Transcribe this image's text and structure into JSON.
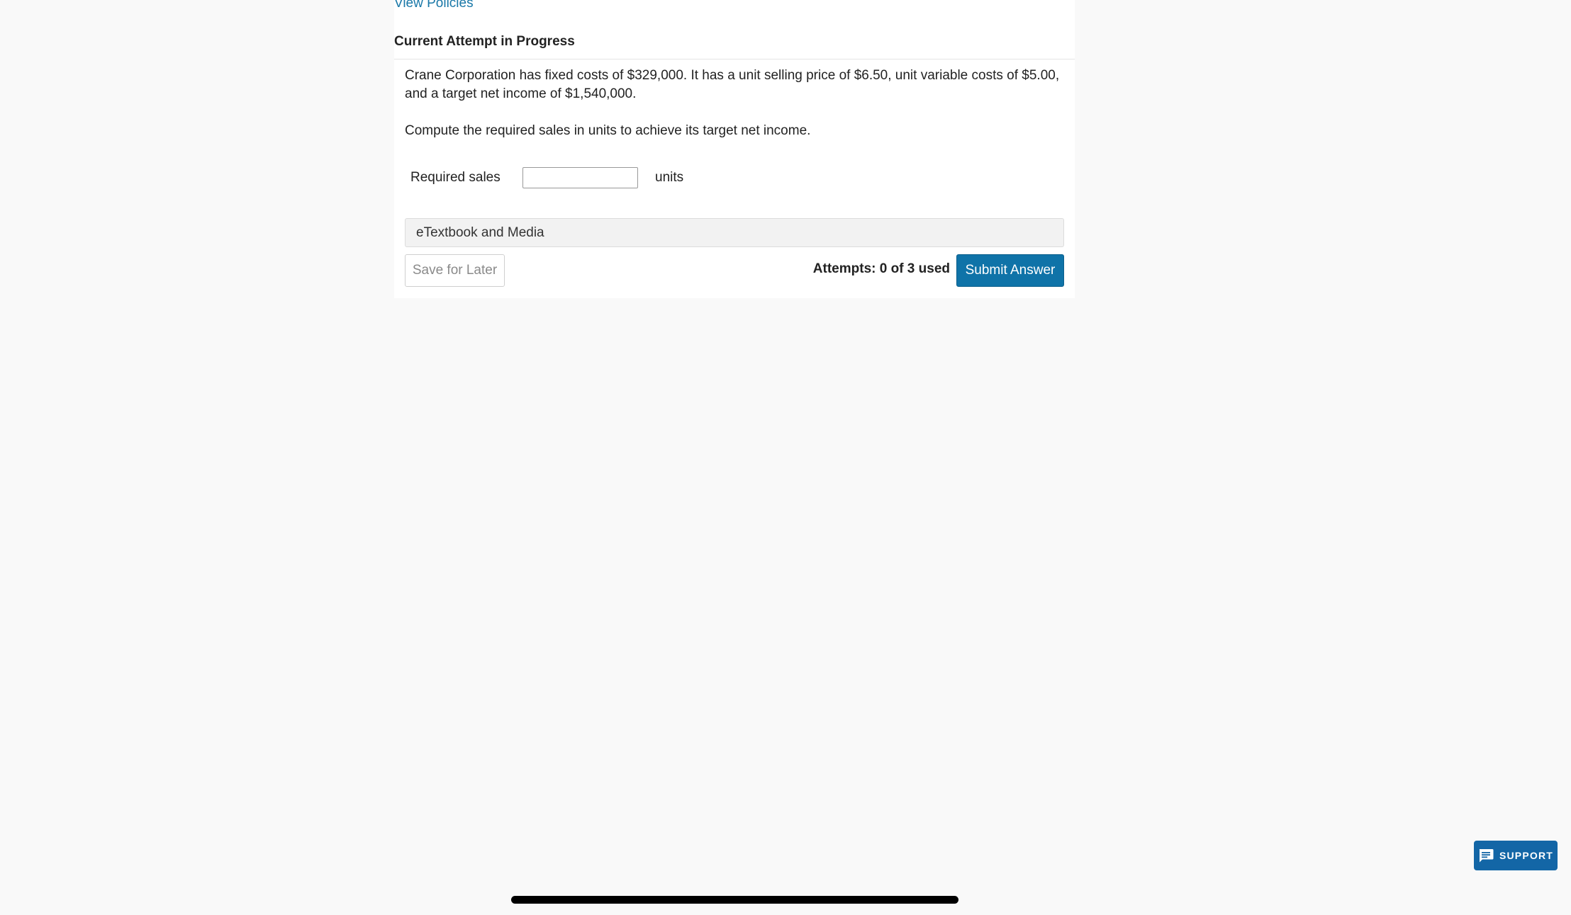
{
  "header": {
    "view_policies_link": "View Policies",
    "attempt_heading": "Current Attempt in Progress"
  },
  "question": {
    "prompt": "Crane Corporation has fixed costs of $329,000. It has a unit selling price of $6.50, unit variable costs of $5.00, and a target net income of $1,540,000.",
    "instruction": "Compute the required sales in units to achieve its target net income.",
    "answer_label": "Required sales",
    "answer_value": "",
    "answer_unit": "units"
  },
  "resources": {
    "etextbook_label": "eTextbook and Media"
  },
  "footer": {
    "save_label": "Save for Later",
    "attempts_text": "Attempts: 0 of 3 used",
    "submit_label": "Submit Answer"
  },
  "support": {
    "label": "SUPPORT",
    "icon": "chat-icon"
  },
  "colors": {
    "link": "#1a78a8",
    "submit_bg": "#0f73a8",
    "support_bg": "#1366a6",
    "page_bg": "#f9f9f9"
  }
}
